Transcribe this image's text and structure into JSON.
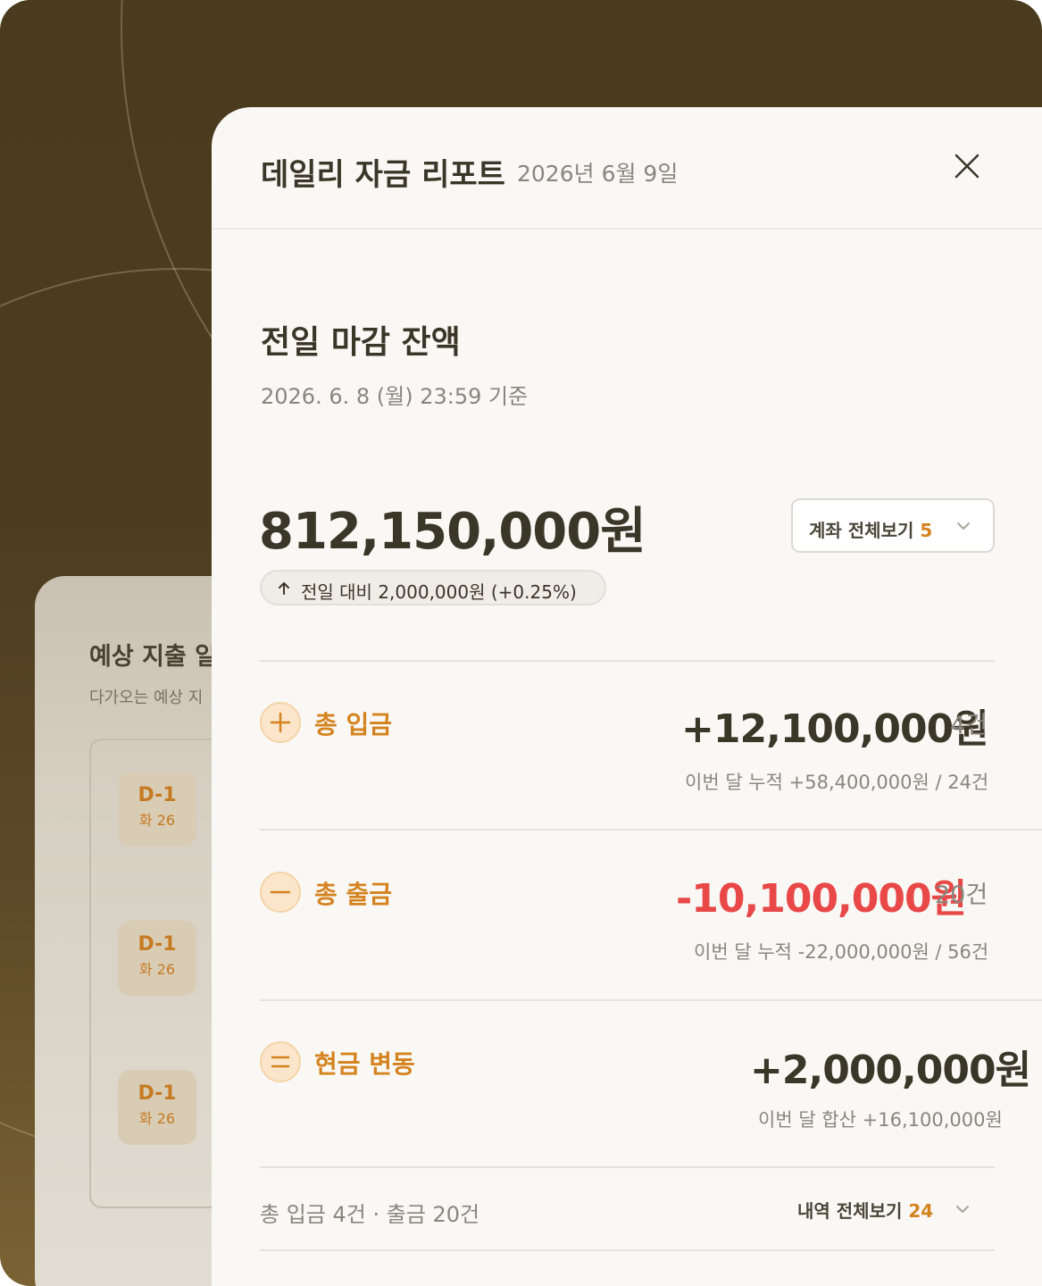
{
  "background_panel": {
    "title": "예상 지출 일",
    "subtitle": "다가오는 예상 지",
    "items": [
      {
        "dday": "D-1",
        "weekday": "화 26"
      },
      {
        "dday": "D-1",
        "weekday": "화 26"
      },
      {
        "dday": "D-1",
        "weekday": "화 26"
      }
    ]
  },
  "modal": {
    "title": "데일리 자금 리포트",
    "date": "2026년 6월 9일",
    "close_icon": "close-icon"
  },
  "balance_section": {
    "title": "전일 마감 잔액",
    "as_of": "2026. 6. 8 (월) 23:59 기준",
    "amount": "812,150,000원",
    "accounts_button": {
      "label": "계좌 전체보기",
      "count": "5"
    },
    "delta": "전일 대비 2,000,000원 (+0.25%)"
  },
  "rows": {
    "deposit": {
      "icon": "plus-icon",
      "label": "총 입금",
      "amount": "+12,100,000원",
      "count": "4건",
      "sub": "이번 달 누적 +58,400,000원 / 24건"
    },
    "withdrawal": {
      "icon": "minus-icon",
      "label": "총 출금",
      "amount": "-10,100,000원",
      "count": "20건",
      "sub": "이번 달 누적 -22,000,000원 / 56건"
    },
    "net": {
      "icon": "equals-icon",
      "label": "현금 변동",
      "amount": "+2,000,000원",
      "sub": "이번 달 합산 +16,100,000원"
    }
  },
  "footer": {
    "summary": "총 입금 4건 · 출금 20건",
    "history_button": {
      "label": "내역 전체보기",
      "count": "24"
    }
  },
  "colors": {
    "accent": "#d4831f",
    "negative": "#e84848",
    "text": "#3a3628",
    "muted": "#8a867e"
  }
}
